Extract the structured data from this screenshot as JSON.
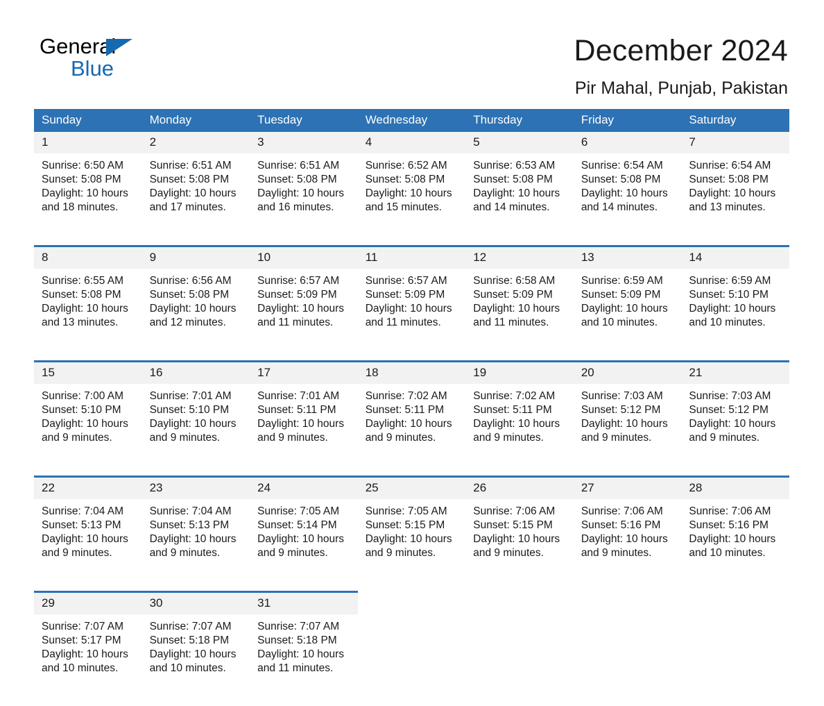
{
  "brand": {
    "name_part1": "General",
    "name_part2": "Blue",
    "accent_color": "#1569b0"
  },
  "header": {
    "title": "December 2024",
    "location": "Pir Mahal, Punjab, Pakistan",
    "header_bg_color": "#2c72b4",
    "daynum_bg_color": "#f2f2f2"
  },
  "weekday_headers": [
    "Sunday",
    "Monday",
    "Tuesday",
    "Wednesday",
    "Thursday",
    "Friday",
    "Saturday"
  ],
  "weeks": [
    {
      "days": [
        {
          "num": "1",
          "sunrise": "Sunrise: 6:50 AM",
          "sunset": "Sunset: 5:08 PM",
          "daylight": "Daylight: 10 hours and 18 minutes."
        },
        {
          "num": "2",
          "sunrise": "Sunrise: 6:51 AM",
          "sunset": "Sunset: 5:08 PM",
          "daylight": "Daylight: 10 hours and 17 minutes."
        },
        {
          "num": "3",
          "sunrise": "Sunrise: 6:51 AM",
          "sunset": "Sunset: 5:08 PM",
          "daylight": "Daylight: 10 hours and 16 minutes."
        },
        {
          "num": "4",
          "sunrise": "Sunrise: 6:52 AM",
          "sunset": "Sunset: 5:08 PM",
          "daylight": "Daylight: 10 hours and 15 minutes."
        },
        {
          "num": "5",
          "sunrise": "Sunrise: 6:53 AM",
          "sunset": "Sunset: 5:08 PM",
          "daylight": "Daylight: 10 hours and 14 minutes."
        },
        {
          "num": "6",
          "sunrise": "Sunrise: 6:54 AM",
          "sunset": "Sunset: 5:08 PM",
          "daylight": "Daylight: 10 hours and 14 minutes."
        },
        {
          "num": "7",
          "sunrise": "Sunrise: 6:54 AM",
          "sunset": "Sunset: 5:08 PM",
          "daylight": "Daylight: 10 hours and 13 minutes."
        }
      ]
    },
    {
      "days": [
        {
          "num": "8",
          "sunrise": "Sunrise: 6:55 AM",
          "sunset": "Sunset: 5:08 PM",
          "daylight": "Daylight: 10 hours and 13 minutes."
        },
        {
          "num": "9",
          "sunrise": "Sunrise: 6:56 AM",
          "sunset": "Sunset: 5:08 PM",
          "daylight": "Daylight: 10 hours and 12 minutes."
        },
        {
          "num": "10",
          "sunrise": "Sunrise: 6:57 AM",
          "sunset": "Sunset: 5:09 PM",
          "daylight": "Daylight: 10 hours and 11 minutes."
        },
        {
          "num": "11",
          "sunrise": "Sunrise: 6:57 AM",
          "sunset": "Sunset: 5:09 PM",
          "daylight": "Daylight: 10 hours and 11 minutes."
        },
        {
          "num": "12",
          "sunrise": "Sunrise: 6:58 AM",
          "sunset": "Sunset: 5:09 PM",
          "daylight": "Daylight: 10 hours and 11 minutes."
        },
        {
          "num": "13",
          "sunrise": "Sunrise: 6:59 AM",
          "sunset": "Sunset: 5:09 PM",
          "daylight": "Daylight: 10 hours and 10 minutes."
        },
        {
          "num": "14",
          "sunrise": "Sunrise: 6:59 AM",
          "sunset": "Sunset: 5:10 PM",
          "daylight": "Daylight: 10 hours and 10 minutes."
        }
      ]
    },
    {
      "days": [
        {
          "num": "15",
          "sunrise": "Sunrise: 7:00 AM",
          "sunset": "Sunset: 5:10 PM",
          "daylight": "Daylight: 10 hours and 9 minutes."
        },
        {
          "num": "16",
          "sunrise": "Sunrise: 7:01 AM",
          "sunset": "Sunset: 5:10 PM",
          "daylight": "Daylight: 10 hours and 9 minutes."
        },
        {
          "num": "17",
          "sunrise": "Sunrise: 7:01 AM",
          "sunset": "Sunset: 5:11 PM",
          "daylight": "Daylight: 10 hours and 9 minutes."
        },
        {
          "num": "18",
          "sunrise": "Sunrise: 7:02 AM",
          "sunset": "Sunset: 5:11 PM",
          "daylight": "Daylight: 10 hours and 9 minutes."
        },
        {
          "num": "19",
          "sunrise": "Sunrise: 7:02 AM",
          "sunset": "Sunset: 5:11 PM",
          "daylight": "Daylight: 10 hours and 9 minutes."
        },
        {
          "num": "20",
          "sunrise": "Sunrise: 7:03 AM",
          "sunset": "Sunset: 5:12 PM",
          "daylight": "Daylight: 10 hours and 9 minutes."
        },
        {
          "num": "21",
          "sunrise": "Sunrise: 7:03 AM",
          "sunset": "Sunset: 5:12 PM",
          "daylight": "Daylight: 10 hours and 9 minutes."
        }
      ]
    },
    {
      "days": [
        {
          "num": "22",
          "sunrise": "Sunrise: 7:04 AM",
          "sunset": "Sunset: 5:13 PM",
          "daylight": "Daylight: 10 hours and 9 minutes."
        },
        {
          "num": "23",
          "sunrise": "Sunrise: 7:04 AM",
          "sunset": "Sunset: 5:13 PM",
          "daylight": "Daylight: 10 hours and 9 minutes."
        },
        {
          "num": "24",
          "sunrise": "Sunrise: 7:05 AM",
          "sunset": "Sunset: 5:14 PM",
          "daylight": "Daylight: 10 hours and 9 minutes."
        },
        {
          "num": "25",
          "sunrise": "Sunrise: 7:05 AM",
          "sunset": "Sunset: 5:15 PM",
          "daylight": "Daylight: 10 hours and 9 minutes."
        },
        {
          "num": "26",
          "sunrise": "Sunrise: 7:06 AM",
          "sunset": "Sunset: 5:15 PM",
          "daylight": "Daylight: 10 hours and 9 minutes."
        },
        {
          "num": "27",
          "sunrise": "Sunrise: 7:06 AM",
          "sunset": "Sunset: 5:16 PM",
          "daylight": "Daylight: 10 hours and 9 minutes."
        },
        {
          "num": "28",
          "sunrise": "Sunrise: 7:06 AM",
          "sunset": "Sunset: 5:16 PM",
          "daylight": "Daylight: 10 hours and 10 minutes."
        }
      ]
    },
    {
      "days": [
        {
          "num": "29",
          "sunrise": "Sunrise: 7:07 AM",
          "sunset": "Sunset: 5:17 PM",
          "daylight": "Daylight: 10 hours and 10 minutes."
        },
        {
          "num": "30",
          "sunrise": "Sunrise: 7:07 AM",
          "sunset": "Sunset: 5:18 PM",
          "daylight": "Daylight: 10 hours and 10 minutes."
        },
        {
          "num": "31",
          "sunrise": "Sunrise: 7:07 AM",
          "sunset": "Sunset: 5:18 PM",
          "daylight": "Daylight: 10 hours and 11 minutes."
        },
        {
          "num": "",
          "sunrise": "",
          "sunset": "",
          "daylight": ""
        },
        {
          "num": "",
          "sunrise": "",
          "sunset": "",
          "daylight": ""
        },
        {
          "num": "",
          "sunrise": "",
          "sunset": "",
          "daylight": ""
        },
        {
          "num": "",
          "sunrise": "",
          "sunset": "",
          "daylight": ""
        }
      ]
    }
  ]
}
